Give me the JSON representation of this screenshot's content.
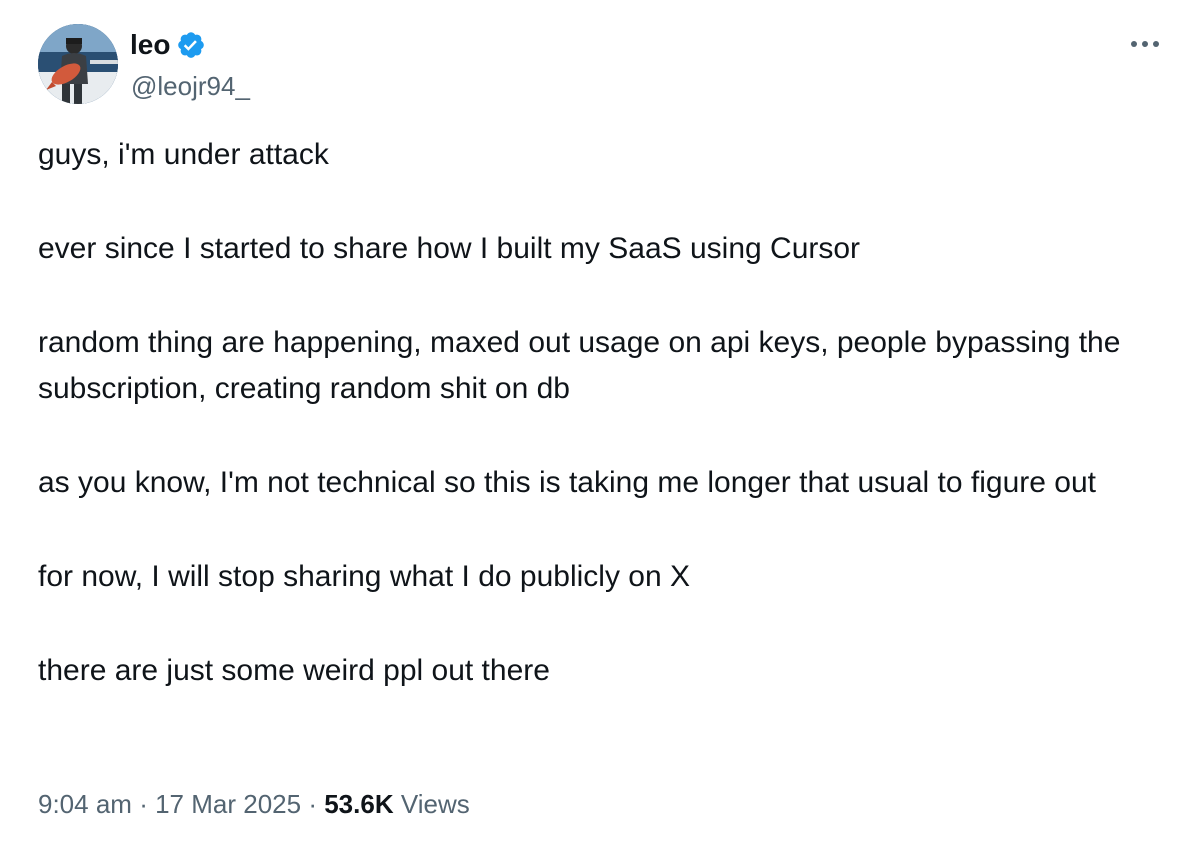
{
  "author": {
    "display_name": "leo",
    "handle": "@leojr94_",
    "verified": true,
    "avatar_icon": "avatar-photo-icon",
    "verified_color": "#1d9bf0"
  },
  "tweet": {
    "paragraphs": [
      "guys, i'm under attack",
      "ever since I started to share how I built my SaaS using Cursor",
      "random thing are happening, maxed out usage on api keys, people bypassing the subscription, creating random shit on db",
      "as you know, I'm not technical so this is taking me longer that usual to figure out",
      "for now, I will stop sharing what I do publicly on X",
      "there are just some weird ppl out there"
    ]
  },
  "meta": {
    "time": "9:04 am",
    "separator": "·",
    "date": "17 Mar 2025",
    "views_count": "53.6K",
    "views_label": "Views"
  },
  "icons": {
    "more": "more-horizontal-icon"
  },
  "colors": {
    "text": "#0f1419",
    "secondary": "#536471",
    "accent": "#1d9bf0"
  }
}
